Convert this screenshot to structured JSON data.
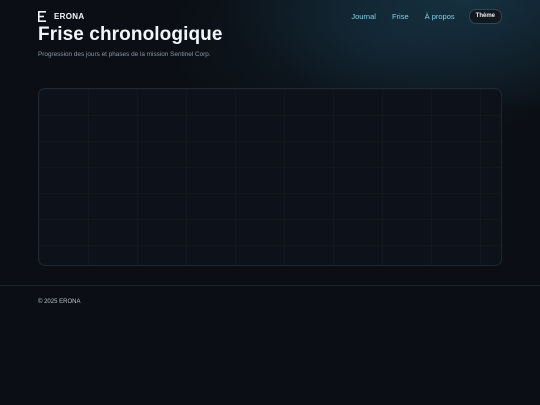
{
  "brand": {
    "name": "ERONA",
    "logo_icon": "stacked-lines-e-logo"
  },
  "nav": {
    "items": [
      {
        "label": "Journal"
      },
      {
        "label": "Frise"
      },
      {
        "label": "À propos"
      }
    ],
    "theme_button_label": "Thème"
  },
  "page": {
    "title": "Frise chronologique",
    "subtitle": "Progression des jours et phases de la mission Sentinel Corp."
  },
  "footer": {
    "copyright": "© 2025 ERONA"
  },
  "colors": {
    "background": "#0b0f15",
    "accent_link": "#7fd3e6",
    "title": "#f4f7fa",
    "muted_text": "#8b97a3"
  }
}
